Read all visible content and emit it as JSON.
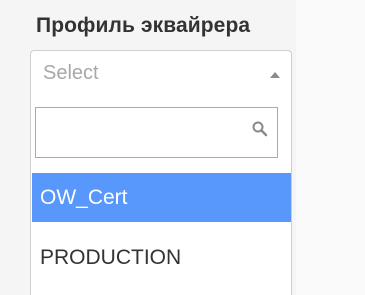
{
  "field": {
    "label": "Профиль эквайрера"
  },
  "select": {
    "placeholder": "Select",
    "state": "open"
  },
  "search": {
    "value": "",
    "placeholder": ""
  },
  "options": [
    {
      "label": "OW_Cert",
      "highlighted": true
    },
    {
      "label": "PRODUCTION",
      "highlighted": false
    }
  ],
  "icons": {
    "caret": "caret-up-icon",
    "search": "search-icon"
  },
  "colors": {
    "highlight": "#5897fb",
    "label_text": "#333333",
    "placeholder_text": "#a8a8a8",
    "border": "#cfcfcf"
  }
}
